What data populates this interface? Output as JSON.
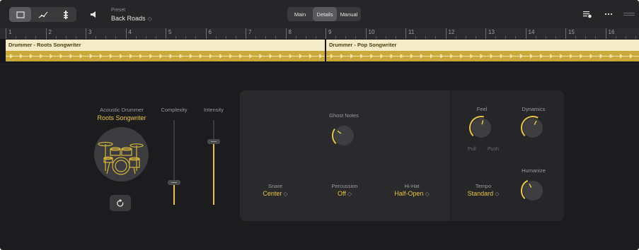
{
  "toolbar": {
    "view_buttons": [
      "editor-view-icon",
      "automation-icon",
      "step-icon"
    ],
    "speaker_icon": "speaker-icon",
    "preset_label": "Preset",
    "preset_value": "Back Roads",
    "tabs": [
      "Main",
      "Details",
      "Manual"
    ],
    "active_tab": "Details",
    "right_icons": [
      "settings-sliders-icon",
      "more-icon",
      "lines-icon"
    ]
  },
  "ruler": {
    "bars": [
      "1",
      "2",
      "3",
      "4",
      "5",
      "6",
      "7",
      "8",
      "9",
      "10",
      "11",
      "12",
      "13",
      "14",
      "15",
      "16"
    ]
  },
  "track": {
    "regions": [
      {
        "name": "Drummer - Roots Songwriter"
      },
      {
        "name": "Drummer - Pop Songwriter"
      }
    ]
  },
  "drummer": {
    "title": "Acoustic Drummer",
    "name": "Roots Songwriter"
  },
  "sliders": {
    "complexity": {
      "label": "Complexity",
      "value": 0.27
    },
    "intensity": {
      "label": "Intensity",
      "value": 0.75
    }
  },
  "controls": {
    "ghost_notes": {
      "label": "Ghost Notes",
      "value": 0.3
    },
    "snare": {
      "label": "Snare",
      "value": "Center"
    },
    "percussion": {
      "label": "Percussion",
      "value": "Off"
    },
    "hihat": {
      "label": "Hi-Hat",
      "value": "Half-Open"
    },
    "feel": {
      "label": "Feel",
      "value": 0.55,
      "left": "Pull",
      "right": "Push"
    },
    "dynamics": {
      "label": "Dynamics",
      "value": 0.6
    },
    "tempo": {
      "label": "Tempo",
      "value": "Standard"
    },
    "humanize": {
      "label": "Humanize",
      "value": 0.4
    }
  },
  "colors": {
    "accent": "#e8c547",
    "region_header": "#f4ecc8",
    "region_body": "#caa93c",
    "background": "#1c1c1e",
    "panel": "#2a2a2c"
  }
}
